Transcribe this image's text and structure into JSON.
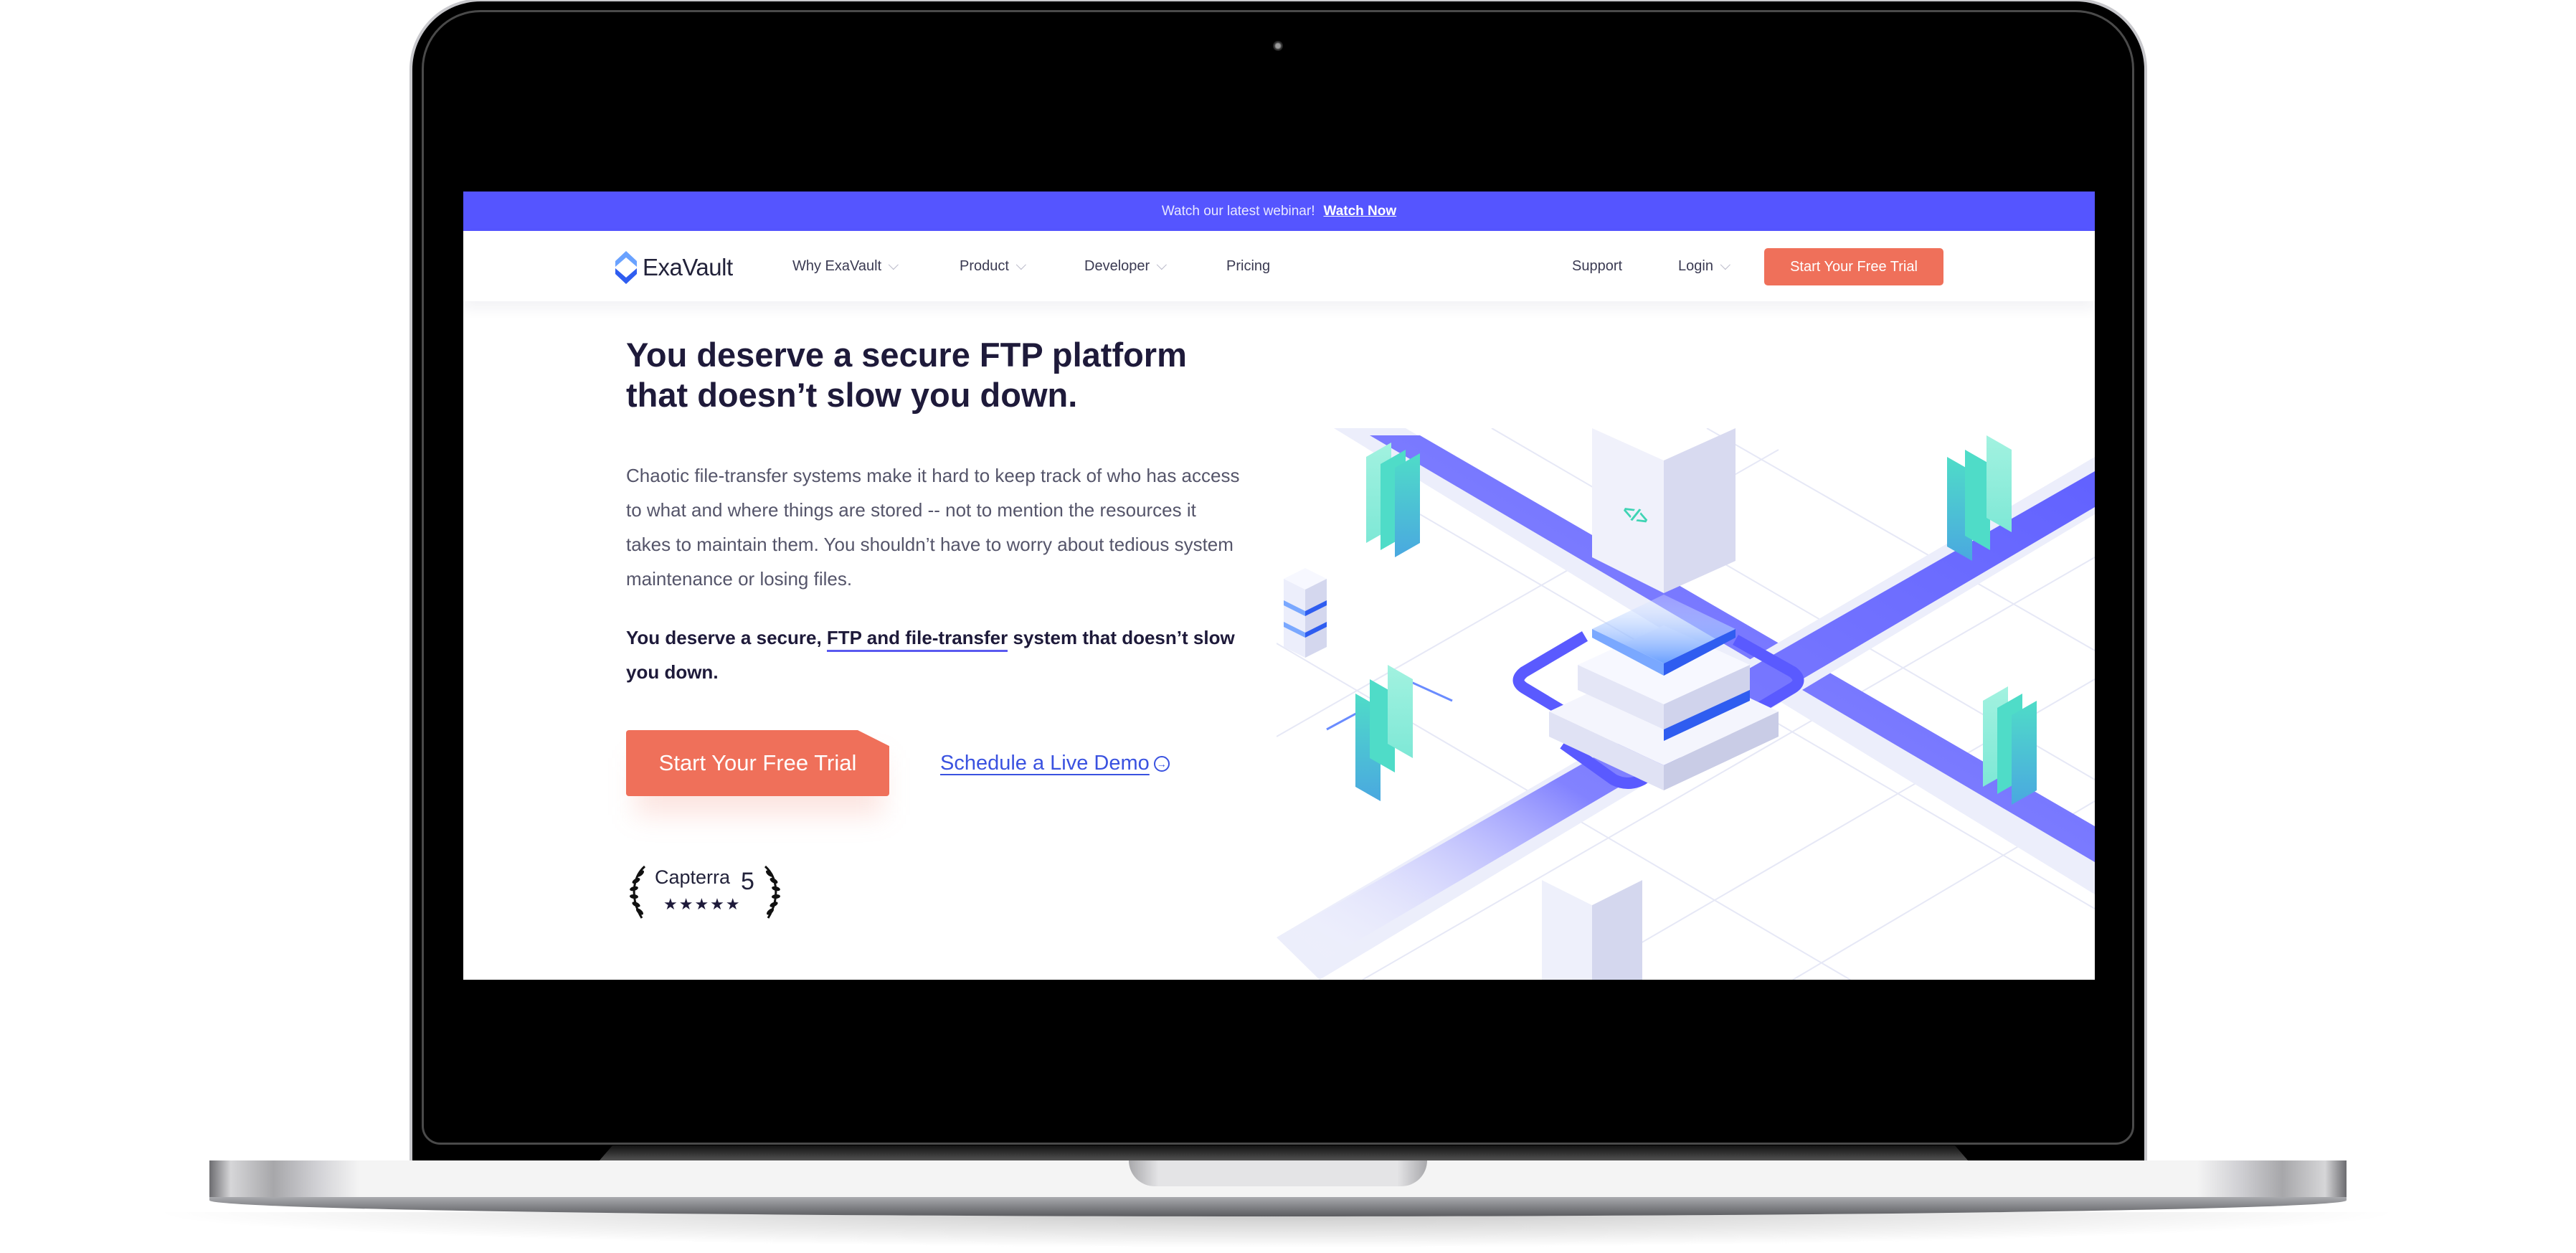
{
  "banner": {
    "text": "Watch our latest webinar!",
    "link_label": "Watch Now"
  },
  "nav": {
    "logo_text": "ExaVault",
    "items": [
      {
        "label": "Why ExaVault",
        "has_dropdown": true
      },
      {
        "label": "Product",
        "has_dropdown": true
      },
      {
        "label": "Developer",
        "has_dropdown": true
      },
      {
        "label": "Pricing",
        "has_dropdown": false
      }
    ],
    "right_items": [
      {
        "label": "Support",
        "has_dropdown": false
      },
      {
        "label": "Login",
        "has_dropdown": true
      }
    ],
    "cta_label": "Start Your Free Trial"
  },
  "hero": {
    "title_line1": "You deserve a secure FTP platform",
    "title_line2": "that doesn’t slow you down.",
    "description": "Chaotic file-transfer systems make it hard to keep track of who has access to what and where things are stored -- not to mention the resources it takes to maintain them. You shouldn’t have to worry about tedious system maintenance or losing files.",
    "strong_before": "You deserve a secure, ",
    "strong_highlight": "FTP and file-transfer",
    "strong_after": " system that doesn’t slow you down.",
    "cta_label": "Start Your Free Trial",
    "demo_label": "Schedule a Live Demo",
    "demo_icon": "arrow-right-circle-icon"
  },
  "rating": {
    "source": "Capterra",
    "score": "5",
    "stars": 5,
    "stars_text": "★★★★★"
  },
  "illustration": {
    "code_glyph": "</>"
  },
  "colors": {
    "banner": "#5555ff",
    "cta": "#ef705a",
    "heading": "#1e1a3a",
    "link": "#3a52e0",
    "teal": "#4fdcc8",
    "accent_purple": "#5a5af0"
  }
}
